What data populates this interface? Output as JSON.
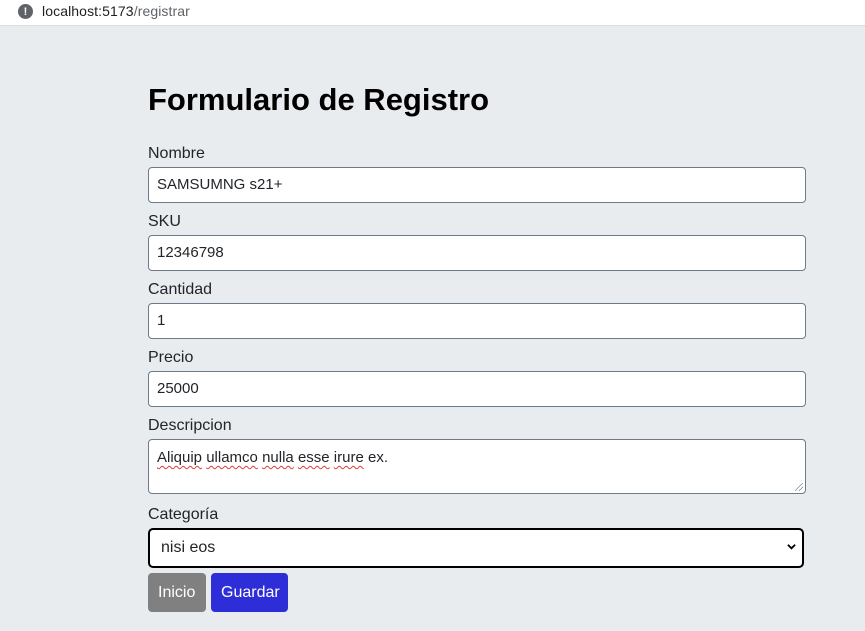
{
  "browser": {
    "url_host": "localhost:5173",
    "url_path": "/registrar",
    "info_icon": "info-icon"
  },
  "form": {
    "title": "Formulario de Registro",
    "nombre": {
      "label": "Nombre",
      "value": "SAMSUMNG s21+"
    },
    "sku": {
      "label": "SKU",
      "value": "12346798"
    },
    "cantidad": {
      "label": "Cantidad",
      "value": "1"
    },
    "precio": {
      "label": "Precio",
      "value": "25000"
    },
    "descripcion": {
      "label": "Descripcion",
      "words": [
        "Aliquip",
        "ullamco",
        "nulla",
        "esse",
        "irure",
        "ex."
      ]
    },
    "categoria": {
      "label": "Categoría",
      "selected": "nisi eos"
    },
    "buttons": {
      "inicio": "Inicio",
      "guardar": "Guardar"
    }
  },
  "colors": {
    "page_bg": "#e9ecef",
    "guardar": "#2e2ed8",
    "inicio": "#808080"
  }
}
